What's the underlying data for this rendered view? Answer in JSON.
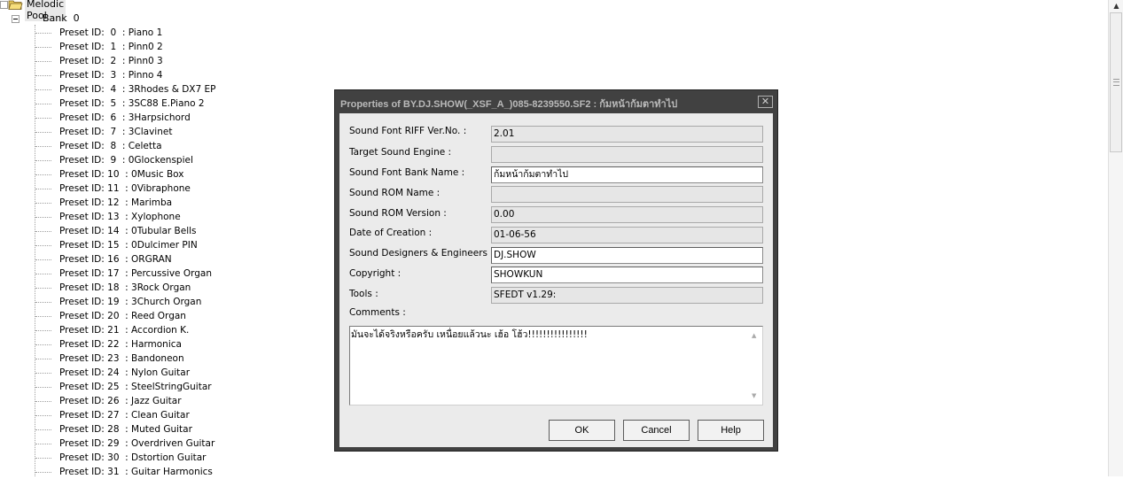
{
  "tree": {
    "root_label": "Melodic Pool",
    "bank_label": "Bank  0",
    "presets": [
      "Preset ID:  0  : Piano 1",
      "Preset ID:  1  : Pinn0 2",
      "Preset ID:  2  : Pinn0 3",
      "Preset ID:  3  : Pinno 4",
      "Preset ID:  4  : 3Rhodes & DX7 EP",
      "Preset ID:  5  : 3SC88 E.Piano 2",
      "Preset ID:  6  : 3Harpsichord",
      "Preset ID:  7  : 3Clavinet",
      "Preset ID:  8  : Celetta",
      "Preset ID:  9  : 0Glockenspiel",
      "Preset ID: 10  : 0Music Box",
      "Preset ID: 11  : 0Vibraphone",
      "Preset ID: 12  : Marimba",
      "Preset ID: 13  : Xylophone",
      "Preset ID: 14  : 0Tubular Bells",
      "Preset ID: 15  : 0Dulcimer PIN",
      "Preset ID: 16  : ORGRAN",
      "Preset ID: 17  : Percussive Organ",
      "Preset ID: 18  : 3Rock Organ",
      "Preset ID: 19  : 3Church Organ",
      "Preset ID: 20  : Reed Organ",
      "Preset ID: 21  : Accordion K.",
      "Preset ID: 22  : Harmonica",
      "Preset ID: 23  : Bandoneon",
      "Preset ID: 24  : Nylon Guitar",
      "Preset ID: 25  : SteelStringGuitar",
      "Preset ID: 26  : Jazz Guitar",
      "Preset ID: 27  : Clean Guitar",
      "Preset ID: 28  : Muted Guitar",
      "Preset ID: 29  : Overdriven Guitar",
      "Preset ID: 30  : Dstortion Guitar",
      "Preset ID: 31  : Guitar Harmonics"
    ]
  },
  "dialog": {
    "title": "Properties of BY.DJ.SHOW(_XSF_A_)085-8239550.SF2 : ก้มหน้าก้มตาทำไป",
    "close_glyph": "✕",
    "fields": [
      {
        "label": "Sound Font RIFF Ver.No. :",
        "value": "2.01"
      },
      {
        "label": "Target Sound Engine :",
        "value": ""
      },
      {
        "label": "Sound Font Bank Name :",
        "value": "ก้มหน้าก้มตาทำไป"
      },
      {
        "label": "Sound ROM Name :",
        "value": ""
      },
      {
        "label": "Sound ROM Version :",
        "value": "0.00"
      },
      {
        "label": "Date of Creation :",
        "value": "01-06-56"
      },
      {
        "label": "Sound Designers & Engineers :",
        "value": "DJ.SHOW"
      },
      {
        "label": "Copyright :",
        "value": "SHOWKUN"
      },
      {
        "label": "Tools :",
        "value": "SFEDT v1.29:"
      }
    ],
    "comments_label": "Comments :",
    "comments_value": "มันจะได้จริงหรือครับ เหนื่อยแล้วนะ เฮ้อ โฮ้ว!!!!!!!!!!!!!!!!",
    "buttons": {
      "ok": "OK",
      "cancel": "Cancel",
      "help": "Help"
    }
  }
}
